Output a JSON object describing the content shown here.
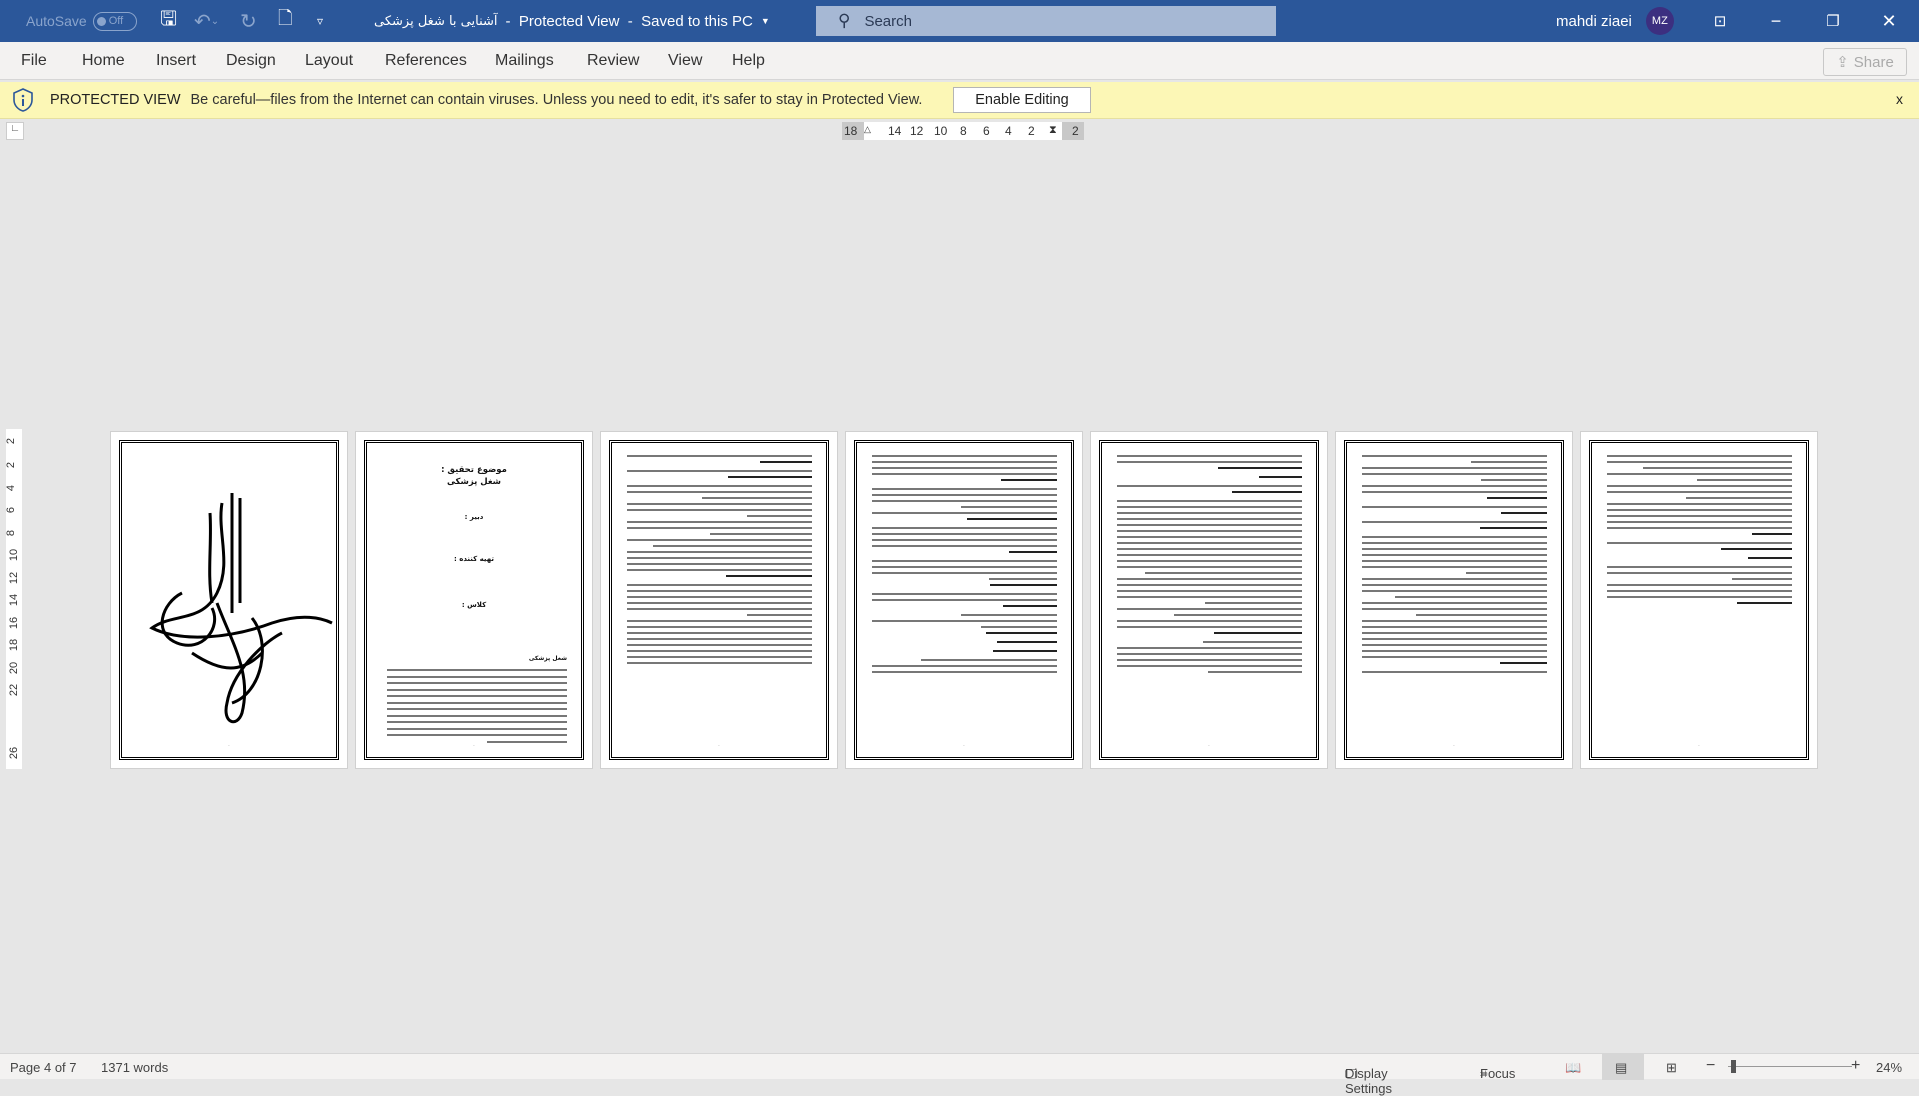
{
  "titlebar": {
    "autosave_label": "AutoSave",
    "autosave_state": "Off",
    "doc_title": "آشنایی با شغل پزشکی",
    "title_suffix": "-  Protected View  -  Saved to this PC",
    "search_placeholder": "Search",
    "user_name": "mahdi ziaei",
    "user_initials": "MZ",
    "accent": "#2b579a"
  },
  "ribbon": {
    "tabs": [
      "File",
      "Home",
      "Insert",
      "Design",
      "Layout",
      "References",
      "Mailings",
      "Review",
      "View",
      "Help"
    ],
    "share_label": "Share"
  },
  "protected_view": {
    "title": "PROTECTED VIEW",
    "message": "Be careful—files from the Internet can contain viruses. Unless you need to edit, it's safer to stay in Protected View.",
    "button": "Enable Editing",
    "close": "x",
    "bg": "#fcf7b6"
  },
  "ruler": {
    "horizontal": [
      "18",
      "14",
      "12",
      "10",
      "8",
      "6",
      "4",
      "2",
      "2"
    ],
    "vertical": [
      "2",
      "2",
      "4",
      "6",
      "8",
      "10",
      "12",
      "14",
      "16",
      "18",
      "20",
      "22",
      "26"
    ]
  },
  "pages": {
    "count": 7,
    "page2": {
      "topic": "موضوع تحقیق :",
      "subject": "شغل پزشکی",
      "teacher": "دبیر :",
      "author": "تهیه کننده :",
      "class": "کلاس :",
      "section_heading": "شغل پزشکی"
    }
  },
  "status": {
    "page": "Page 4 of 7",
    "words": "1371 words",
    "display_settings": "Display Settings",
    "focus": "Focus",
    "zoom": "24%"
  }
}
